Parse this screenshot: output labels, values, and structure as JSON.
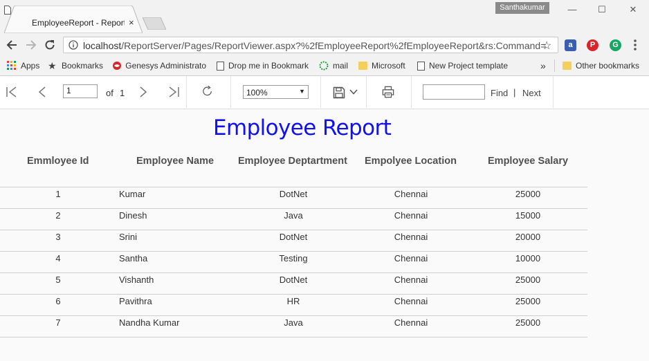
{
  "browser": {
    "tab": {
      "title": "EmployeeReport - Report",
      "close_glyph": "×"
    },
    "user_chip": "Santhakumar",
    "window_controls": {
      "minimize": "—",
      "maximize": "☐",
      "close": "✕"
    },
    "url": {
      "host": "localhost",
      "path": "/ReportServer/Pages/ReportViewer.aspx?%2fEmployeeReport%2fEmployeeReport&rs:Command="
    },
    "bookmarks": [
      {
        "label": "Apps",
        "icon": "apps-grid-icon"
      },
      {
        "label": "Bookmarks",
        "icon": "star-icon"
      },
      {
        "label": "Genesys Administrato",
        "icon": "genesys-icon"
      },
      {
        "label": "Drop me in Bookmark",
        "icon": "page-icon"
      },
      {
        "label": "mail",
        "icon": "mail-icon"
      },
      {
        "label": "Microsoft",
        "icon": "folder-icon"
      },
      {
        "label": "New Project template",
        "icon": "page-icon"
      }
    ],
    "bookmarks_overflow": "»",
    "other_bookmarks": "Other bookmarks",
    "extensions": [
      {
        "name": "extension-a-icon",
        "glyph": "a",
        "color": "#3a5fb0"
      },
      {
        "name": "pinterest-icon",
        "glyph": "P",
        "color": "#d9242a"
      },
      {
        "name": "grammarly-icon",
        "glyph": "G",
        "color": "#16a860"
      }
    ]
  },
  "viewer_toolbar": {
    "page_value": "1",
    "of_label": "of",
    "page_total": "1",
    "zoom": "100%",
    "find_label": "Find",
    "find_separator": "|",
    "next_label": "Next"
  },
  "report": {
    "title": "Employee Report",
    "columns": [
      "Emmloyee Id",
      "Employee Name",
      "Employee Deptartment",
      "Empolyee Location",
      "Employee Salary"
    ],
    "rows": [
      [
        "1",
        "Kumar",
        "DotNet",
        "Chennai",
        "25000"
      ],
      [
        "2",
        "Dinesh",
        "Java",
        "Chennai",
        "15000"
      ],
      [
        "3",
        "Srini",
        "DotNet",
        "Chennai",
        "20000"
      ],
      [
        "4",
        "Santha",
        "Testing",
        "Chennai",
        "10000"
      ],
      [
        "5",
        "Vishanth",
        "DotNet",
        "Chennai",
        "25000"
      ],
      [
        "6",
        "Pavithra",
        "HR",
        "Chennai",
        "25000"
      ],
      [
        "7",
        "Nandha Kumar",
        "Java",
        "Chennai",
        "25000"
      ]
    ]
  },
  "colors": {
    "title_blue": "#1010f0",
    "chrome_bg": "#f2f2f2"
  }
}
